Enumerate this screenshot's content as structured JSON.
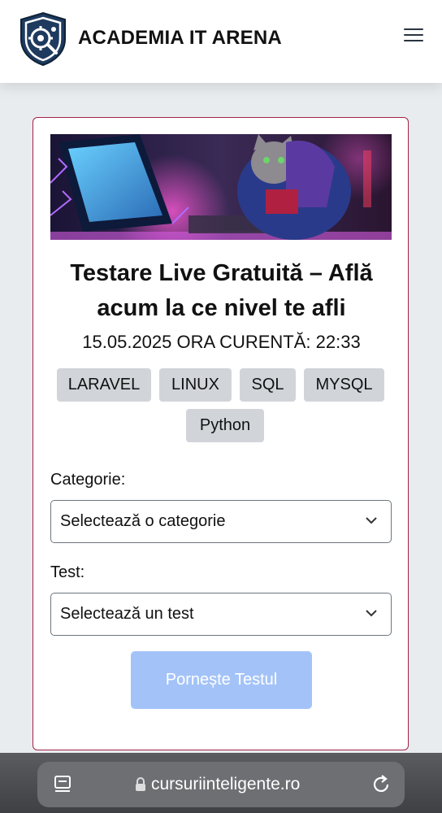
{
  "header": {
    "brand": "ACADEMIA IT ARENA"
  },
  "card": {
    "title_line1": "Testare Live Gratuită – Află",
    "title_line2": "acum la ce nivel te afli",
    "datetime": "15.05.2025 ORA CURENTĂ: 22:33",
    "tags": [
      "LARAVEL",
      "LINUX",
      "SQL",
      "MYSQL",
      "Python"
    ],
    "category_label": "Categorie:",
    "category_select": "Selectează o categorie",
    "test_label": "Test:",
    "test_select": "Selectează un test",
    "start_button": "Pornește Testul"
  },
  "browser": {
    "url": "cursuriinteligente.ro"
  },
  "colors": {
    "card_border": "#a32347",
    "tag_bg": "#d1d5d9",
    "start_button_bg": "#a3c3f8",
    "page_bg": "#e9ecef",
    "logo_shield": "#1e3a5f"
  },
  "icons": {
    "logo": "shield-gear-logo-icon",
    "menu": "hamburger-menu-icon",
    "select_chevron": "chevron-down-icon",
    "tabs": "tabs-icon",
    "lock": "lock-icon",
    "reload": "reload-icon"
  }
}
